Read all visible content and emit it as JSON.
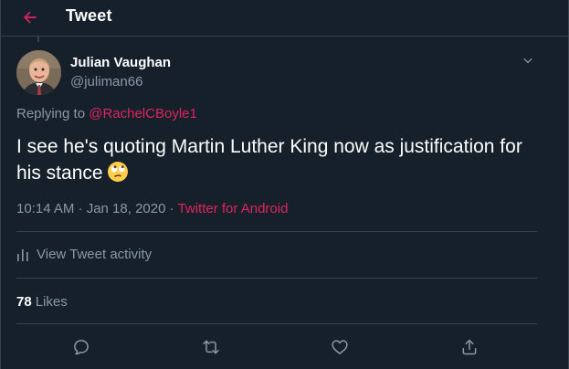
{
  "header": {
    "title": "Tweet",
    "back_icon": "arrow-left-icon",
    "accent_color": "#e0245e"
  },
  "author": {
    "name": "Julian Vaughan",
    "handle": "@juliman66"
  },
  "reply": {
    "prefix": "Replying to",
    "mention": "@RachelCBoyle1"
  },
  "tweet": {
    "text": "I see he's quoting Martin Luther King now as justification for his stance",
    "emoji": "face-with-rolling-eyes"
  },
  "meta": {
    "timestamp": "10:14 AM · Jan 18, 2020 ·",
    "source": "Twitter for Android"
  },
  "activity": {
    "label": "View Tweet activity",
    "icon": "bar-chart-icon"
  },
  "likes": {
    "count": "78",
    "label": "Likes"
  },
  "actions": [
    {
      "name": "reply",
      "icon": "comment-icon"
    },
    {
      "name": "retweet",
      "icon": "retweet-icon"
    },
    {
      "name": "like",
      "icon": "heart-icon"
    },
    {
      "name": "share",
      "icon": "share-icon"
    }
  ],
  "colors": {
    "background": "#15202b",
    "border": "#38444d",
    "secondary_text": "#8899a6",
    "link": "#e0245e"
  }
}
